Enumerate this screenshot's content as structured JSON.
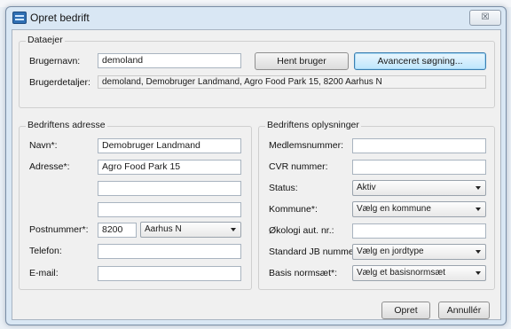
{
  "window": {
    "title": "Opret bedrift",
    "close_symbol": "☒"
  },
  "dataejer": {
    "title": "Dataejer",
    "brugernavn_label": "Brugernavn:",
    "brugernavn_value": "demoland",
    "hent_bruger_label": "Hent bruger",
    "avanceret_label": "Avanceret søgning...",
    "brugerdetaljer_label": "Brugerdetaljer:",
    "brugerdetaljer_value": "demoland, Demobruger Landmand, Agro Food Park 15, 8200 Aarhus N"
  },
  "adresse": {
    "title": "Bedriftens adresse",
    "navn_label": "Navn*:",
    "navn_value": "Demobruger Landmand",
    "adresse_label": "Adresse*:",
    "adresse_value": "Agro Food Park 15",
    "adresse2_value": "",
    "adresse3_value": "",
    "postnummer_label": "Postnummer*:",
    "postnummer_value": "8200",
    "by_value": "Aarhus N",
    "telefon_label": "Telefon:",
    "telefon_value": "",
    "email_label": "E-mail:",
    "email_value": ""
  },
  "oplysninger": {
    "title": "Bedriftens oplysninger",
    "medlemsnummer_label": "Medlemsnummer:",
    "medlemsnummer_value": "",
    "cvr_label": "CVR nummer:",
    "cvr_value": "",
    "status_label": "Status:",
    "status_value": "Aktiv",
    "kommune_label": "Kommune*:",
    "kommune_value": "Vælg en kommune",
    "okologi_label": "Økologi aut. nr.:",
    "okologi_value": "",
    "jb_label": "Standard JB nummer:",
    "jb_value": "Vælg en jordtype",
    "basis_label": "Basis normsæt*:",
    "basis_value": "Vælg et basisnormsæt"
  },
  "buttons": {
    "opret_label": "Opret",
    "annuller_label": "Annullér"
  }
}
